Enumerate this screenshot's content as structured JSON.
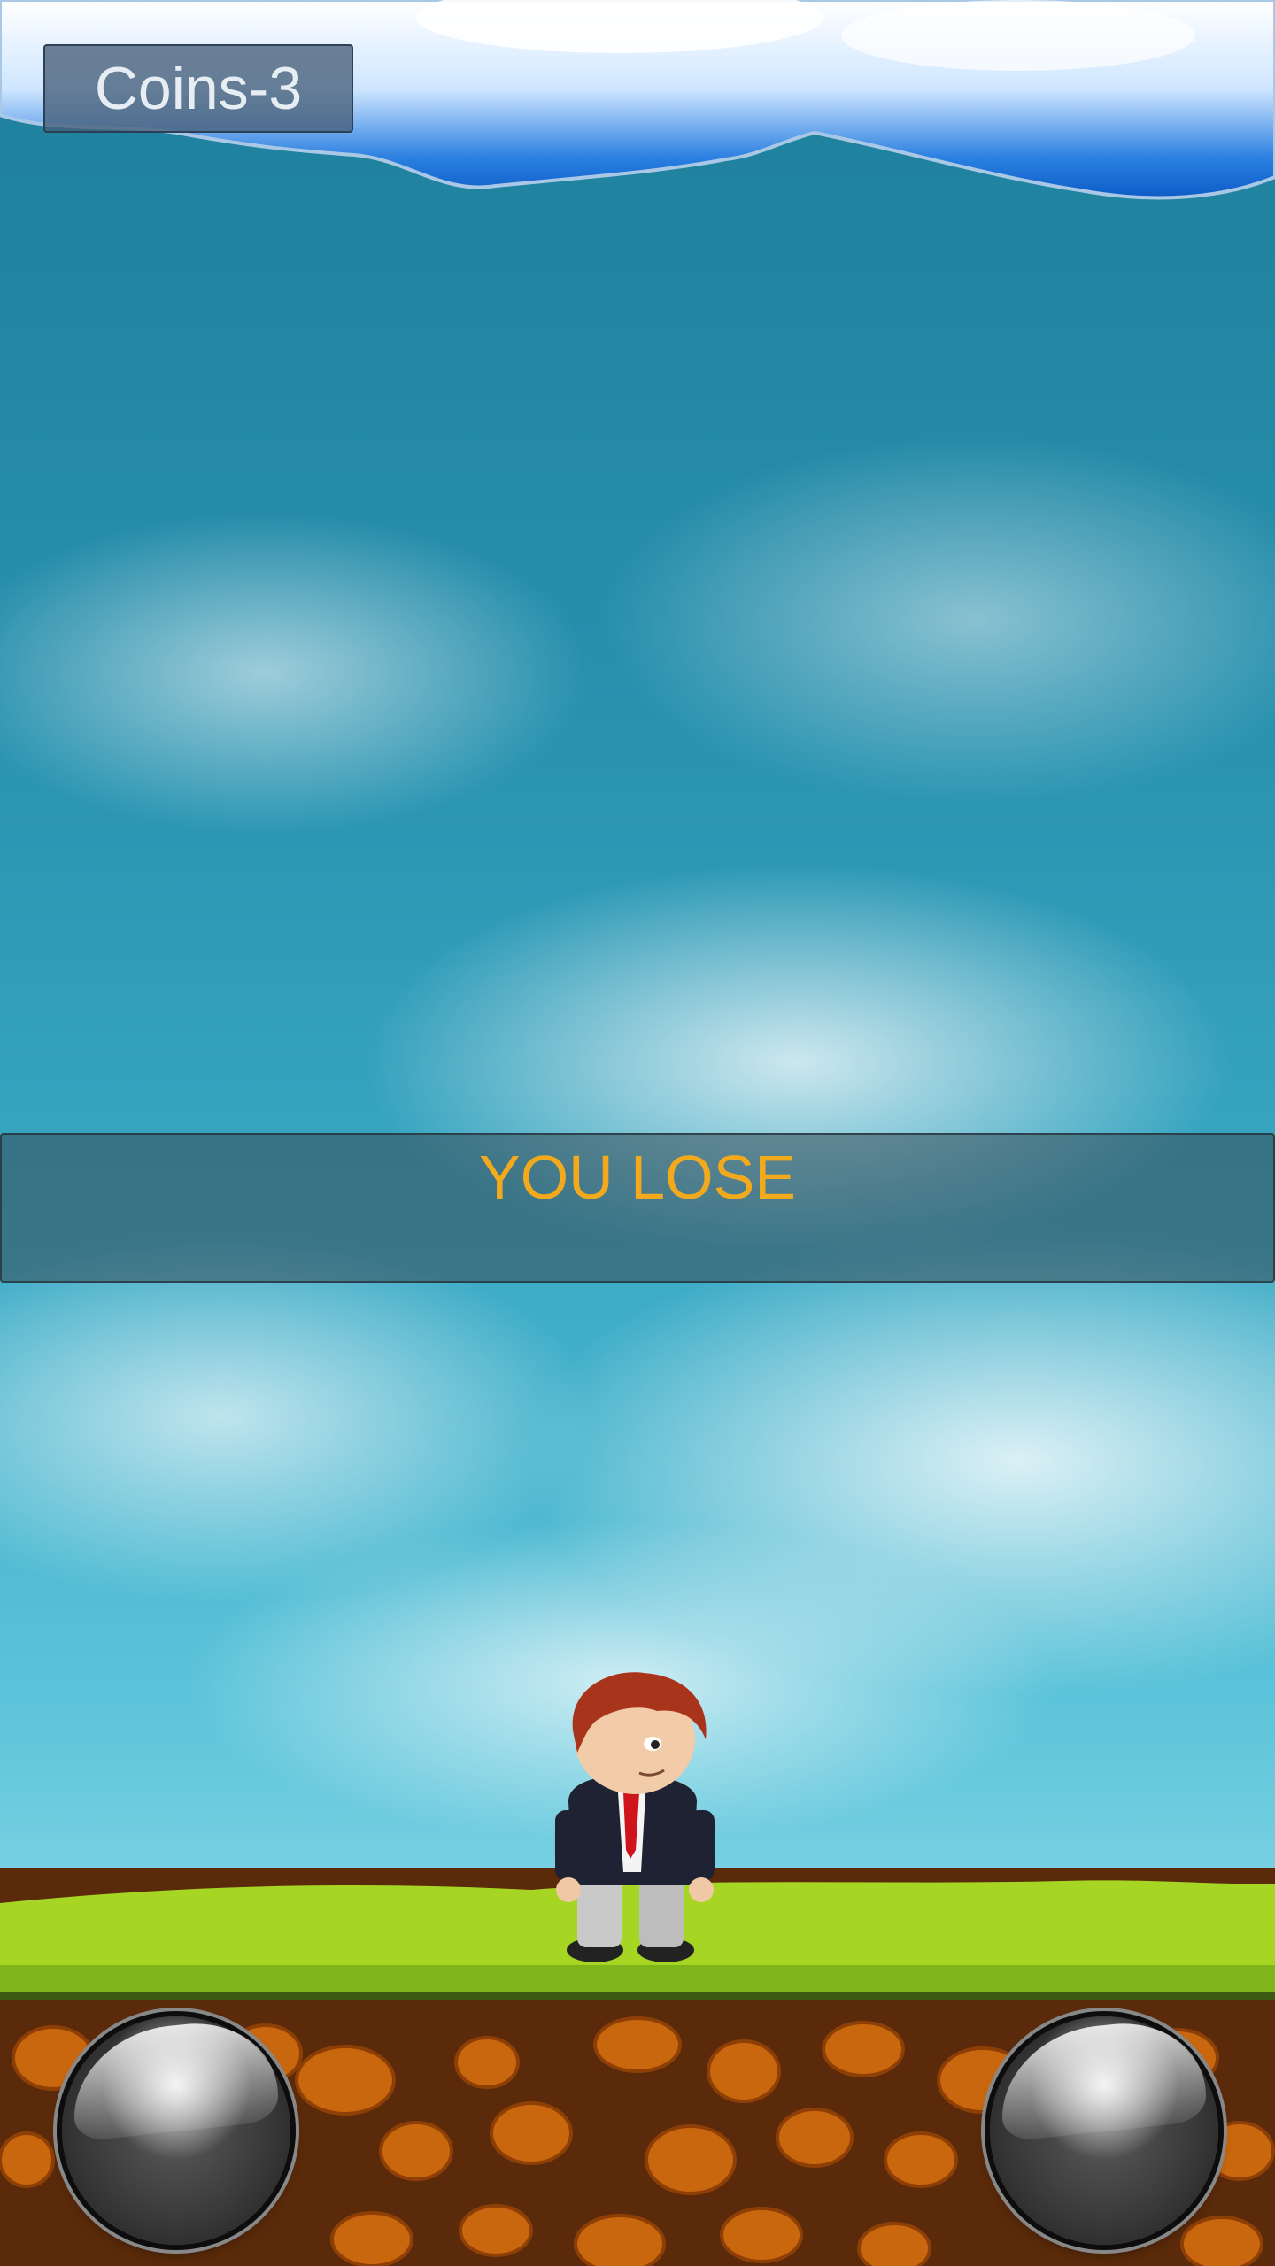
{
  "hud": {
    "coins_label": "Coins-3"
  },
  "result": {
    "message": "YOU LOSE"
  },
  "controls": {
    "left_icon": "round-gray-button",
    "right_icon": "round-gray-button"
  },
  "colors": {
    "result_text": "#f2a91c",
    "grass": "#9ccd1f",
    "dirt": "#5a2a0a",
    "stone": "#c8670e"
  }
}
